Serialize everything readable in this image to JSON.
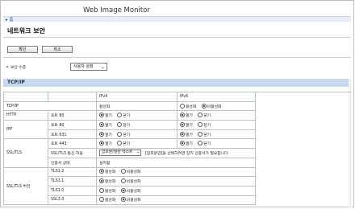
{
  "app": {
    "title": "Web Image Monitor",
    "home_link": "홈"
  },
  "page": {
    "title": "네트워크 보안"
  },
  "toolbar": {
    "ok_label": "확인",
    "cancel_label": "취소"
  },
  "security_level": {
    "label": "보안 수준",
    "value": "사용자 설정"
  },
  "section": {
    "title": "TCP/IP"
  },
  "table": {
    "headers": {
      "ipv4": "IPv4",
      "ipv6": "IPv6"
    },
    "rows": {
      "tcpip": {
        "label": "TCP/IP",
        "ipv4_status": "활성화",
        "ipv6_on": "활성화",
        "ipv6_off": "비활성화"
      },
      "http": {
        "label": "HTTP",
        "port": "포트 80",
        "open": "열기",
        "close": "닫기"
      },
      "ipp": {
        "label": "IPP",
        "port80": "포트 80",
        "port631": "포트 631",
        "open": "열기",
        "close": "닫기"
      },
      "ssl": {
        "label": "SSL/TLS",
        "port": "포트 443",
        "open": "열기",
        "close": "닫기",
        "comm_label": "SSL/TLS 통신 허용",
        "comm_value": "암호문/일반 텍스트",
        "comm_note": "[암호문만]을 선택하려면 장치 인증서가 필요합니다.",
        "cert_label": "인증서 상태",
        "cert_value": "설치됨"
      },
      "version": {
        "label": "SSL/TLS 버전",
        "on": "활성화",
        "off": "비활성화",
        "items": [
          "TLS1.2",
          "TLS1.1",
          "TLS1.0",
          "SSL3.0"
        ]
      }
    }
  }
}
